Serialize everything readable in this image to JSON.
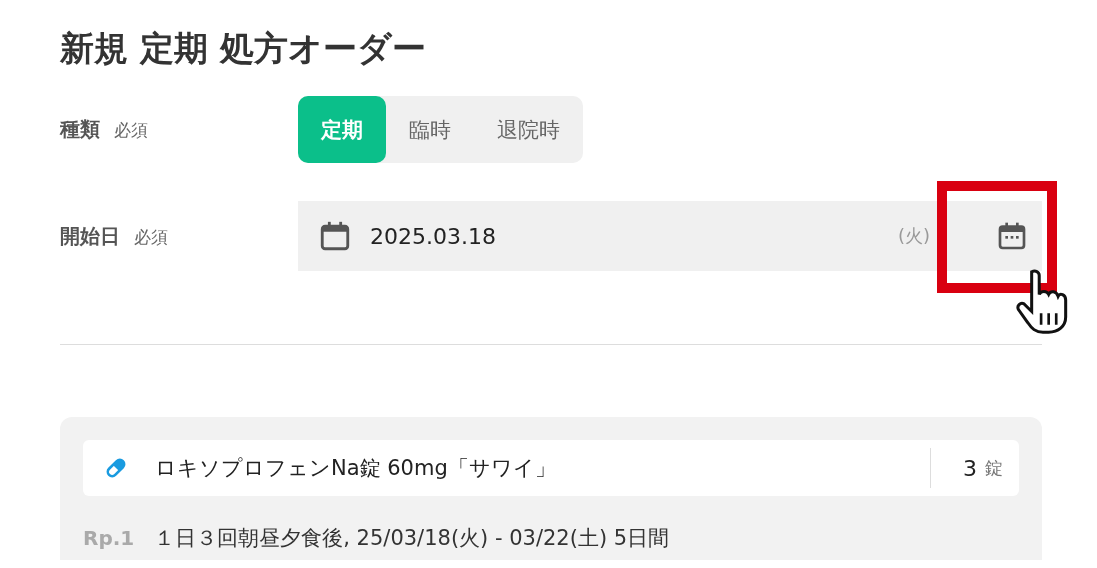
{
  "title": "新規 定期 処方オーダー",
  "fields": [
    {
      "label": "種類",
      "required": "必須",
      "kind": "segments",
      "options": [
        {
          "label": "定期",
          "selected": true
        },
        {
          "label": "臨時",
          "selected": false
        },
        {
          "label": "退院時",
          "selected": false
        }
      ]
    },
    {
      "label": "開始日",
      "required": "必須",
      "kind": "date",
      "value": "2025.03.18",
      "weekday": "(火)"
    }
  ],
  "order": {
    "drug": "ロキソプロフェンNa錠 60mg「サワイ」",
    "quantity": "3",
    "unit": "錠",
    "rp": "Rp.1",
    "usage": "１日３回朝昼夕食後,  25/03/18(火) - 03/22(土) 5日間"
  }
}
